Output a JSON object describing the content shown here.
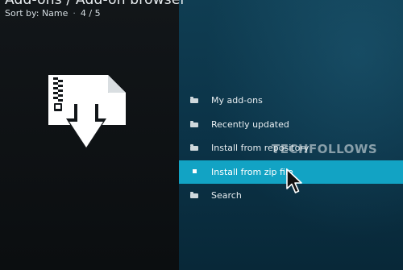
{
  "header": {
    "title": "Add-ons / Add-on browser",
    "sort_label": "Sort by: Name",
    "position": "4 / 5"
  },
  "preview": {
    "icon": "zip-file-install-icon"
  },
  "menu": {
    "items": [
      {
        "label": "My add-ons",
        "icon": "folder-icon",
        "selected": false
      },
      {
        "label": "Recently updated",
        "icon": "folder-icon",
        "selected": false
      },
      {
        "label": "Install from repository",
        "icon": "folder-icon",
        "selected": false
      },
      {
        "label": "Install from zip file",
        "icon": "bullet-icon",
        "selected": true
      },
      {
        "label": "Search",
        "icon": "folder-icon",
        "selected": false
      }
    ]
  },
  "watermark": "TECHFOLLOWS",
  "colors": {
    "selection": "#12a3c4",
    "right_pane": "#0b3246",
    "left_pane": "#0f1315"
  }
}
